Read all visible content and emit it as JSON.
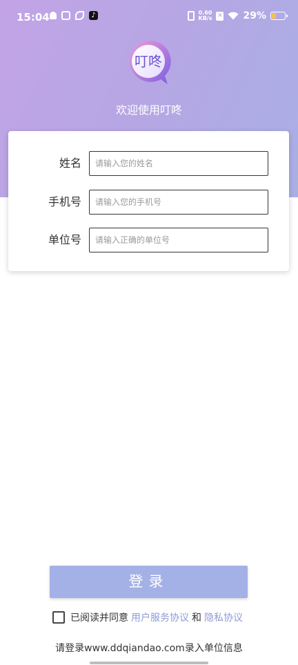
{
  "status_bar": {
    "time": "15:04",
    "net_speed_value": "0.60",
    "net_speed_unit": "KB/s",
    "battery": "29%",
    "battery_level": 0.29,
    "icons": [
      "bell-icon",
      "box-icon",
      "leaf-icon",
      "tiktok-icon",
      "vibrate-icon",
      "sim-icon",
      "wifi-icon",
      "battery-icon"
    ]
  },
  "header": {
    "logo_text": "叮咚",
    "welcome": "欢迎使用叮咚"
  },
  "form": {
    "name_label": "姓名",
    "name_placeholder": "请输入您的姓名",
    "phone_label": "手机号",
    "phone_placeholder": "请输入您的手机号",
    "unit_label": "单位号",
    "unit_placeholder": "请输入正确的单位号"
  },
  "login": {
    "button_label": "登录"
  },
  "agreement": {
    "prefix": "已阅读并同意",
    "user_agreement": "用户服务协议",
    "conjunction": "和",
    "privacy_policy": "隐私协议"
  },
  "footer": {
    "text": "请登录www.ddqiandao.com录入单位信息"
  },
  "colors": {
    "hero_gradient_start": "#c2a4e6",
    "hero_gradient_end": "#a9afe4",
    "button": "#a4b1e6",
    "link": "#8e9ad8",
    "battery_fill": "#f4c447"
  }
}
